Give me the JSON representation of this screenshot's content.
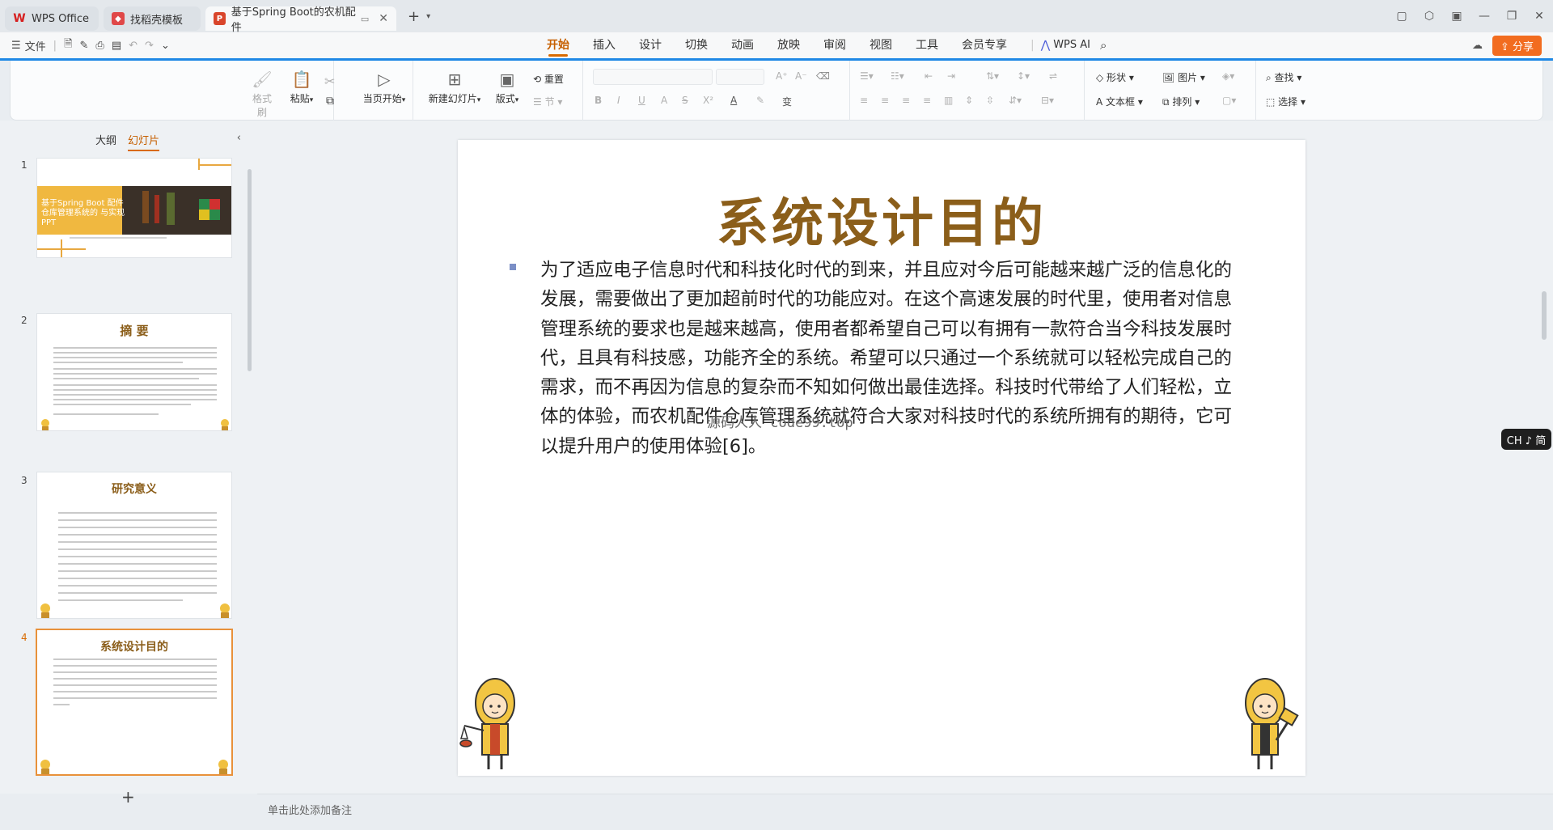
{
  "tabs": [
    {
      "label": "WPS Office"
    },
    {
      "label": "找稻壳模板"
    },
    {
      "label": "基于Spring Boot的农机配件"
    }
  ],
  "menubar": {
    "file_label": "文件",
    "ribbon_tabs": [
      "开始",
      "插入",
      "设计",
      "切换",
      "动画",
      "放映",
      "审阅",
      "视图",
      "工具",
      "会员专享"
    ],
    "wps_ai_label": "WPS AI",
    "share_label": "分享"
  },
  "ribbon": {
    "format_painter": "格式刷",
    "paste": "粘贴",
    "from_current": "当页开始",
    "new_slide": "新建幻灯片",
    "layout": "版式",
    "reset": "重置",
    "section": "节",
    "shape": "形状",
    "picture": "图片",
    "textbox": "文本框",
    "arrange": "排列",
    "find": "查找",
    "select": "选择"
  },
  "left_panel": {
    "tab_outline": "大纲",
    "tab_slides": "幻灯片",
    "thumbnails": [
      {
        "number": "1",
        "title": "基于Spring Boot 配件仓库管理系统的 与实现PPT"
      },
      {
        "number": "2",
        "title": "摘 要"
      },
      {
        "number": "3",
        "title": "研究意义"
      },
      {
        "number": "4",
        "title": "系统设计目的"
      }
    ]
  },
  "slide": {
    "title": "系统设计目的",
    "body": "为了适应电子信息时代和科技化时代的到来，并且应对今后可能越来越广泛的信息化的发展，需要做出了更加超前时代的功能应对。在这个高速发展的时代里，使用者对信息管理系统的要求也是越来越高，使用者都希望自己可以有拥有一款符合当今科技发展时代，且具有科技感，功能齐全的系统。希望可以只通过一个系统就可以轻松完成自己的需求，而不再因为信息的复杂而不知如何做出最佳选择。科技时代带给了人们轻松，立体的体验，而农机配件仓库管理系统就符合大家对科技时代的系统所拥有的期待，它可以提升用户的使用体验[6]。",
    "watermark": "源码人人 code99.top"
  },
  "notes_placeholder": "单击此处添加备注",
  "ime_badge": "CH ♪ 简",
  "colors": {
    "accent": "#d96a00",
    "title": "#8b5e1a",
    "share": "#f26c1f",
    "blueline": "#1e88e5"
  }
}
